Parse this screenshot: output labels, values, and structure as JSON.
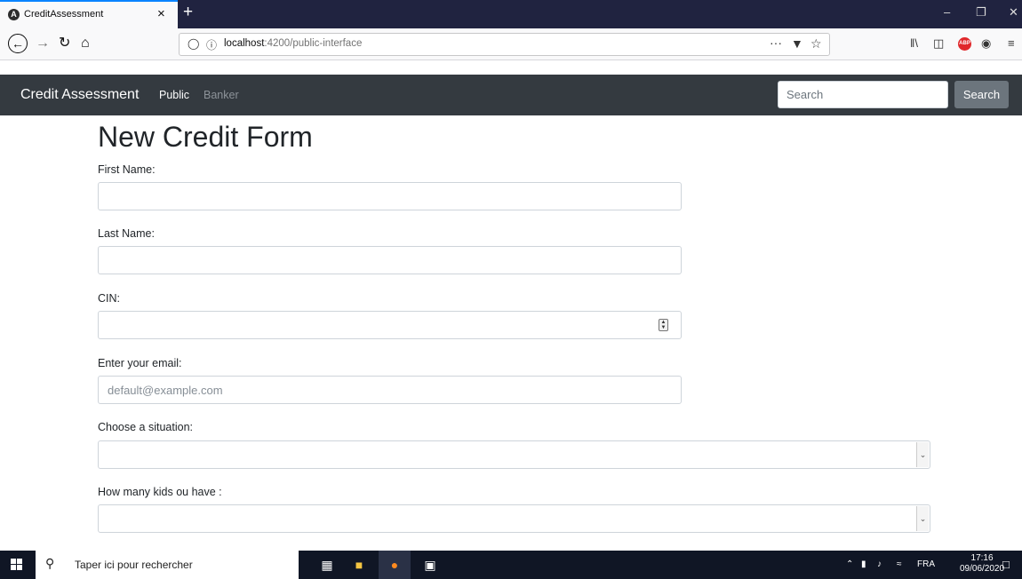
{
  "browser": {
    "tab_title": "CreditAssessment",
    "tab_close": "×",
    "new_tab": "+",
    "url_host": "localhost",
    "url_path": ":4200/public-interface",
    "url_more": "···"
  },
  "navbar": {
    "brand": "Credit Assessment",
    "links": [
      {
        "label": "Public",
        "active": true
      },
      {
        "label": "Banker",
        "active": false
      }
    ],
    "search_placeholder": "Search",
    "search_button": "Search"
  },
  "form": {
    "title": "New Credit Form",
    "fields": [
      {
        "label": "First Name:",
        "value": "",
        "placeholder": ""
      },
      {
        "label": "Last Name:",
        "value": "",
        "placeholder": ""
      },
      {
        "label": "CIN:",
        "value": "",
        "placeholder": ""
      },
      {
        "label": "Enter your email:",
        "value": "",
        "placeholder": "default@example.com"
      },
      {
        "label": "Choose a situation:",
        "value": ""
      },
      {
        "label": "How many kids ou have :",
        "value": ""
      }
    ]
  },
  "taskbar": {
    "search_text": "Taper ici pour rechercher",
    "language": "FRA",
    "time": "17:16",
    "date": "09/06/2020"
  }
}
